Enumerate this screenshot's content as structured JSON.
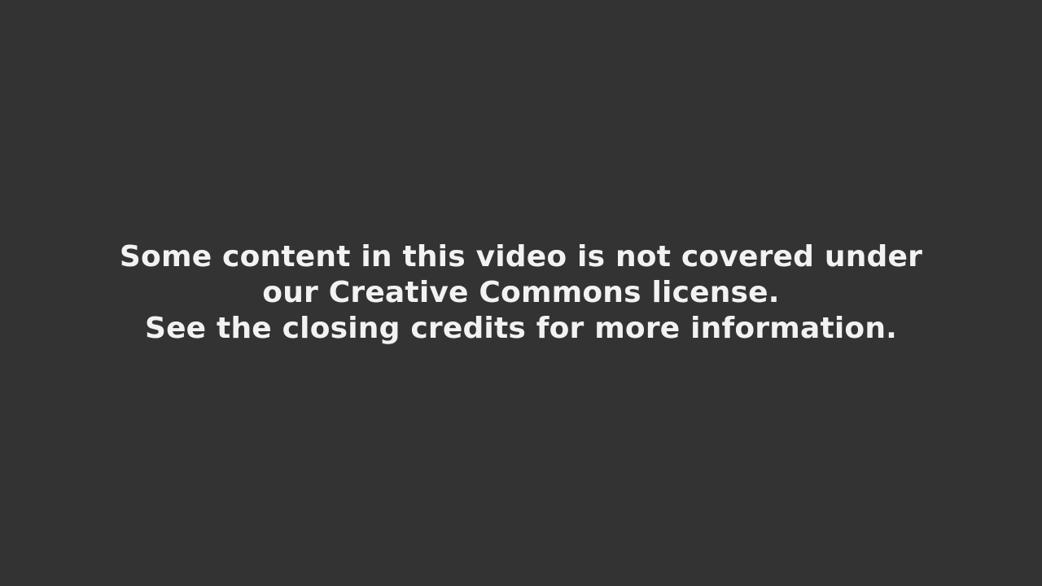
{
  "screen": {
    "background_color": "#333333",
    "text_color": "#f2f2f2"
  },
  "notice": {
    "lines": [
      "Some content in this video is not covered under",
      "our Creative Commons license.",
      "See the closing credits for more information."
    ]
  }
}
